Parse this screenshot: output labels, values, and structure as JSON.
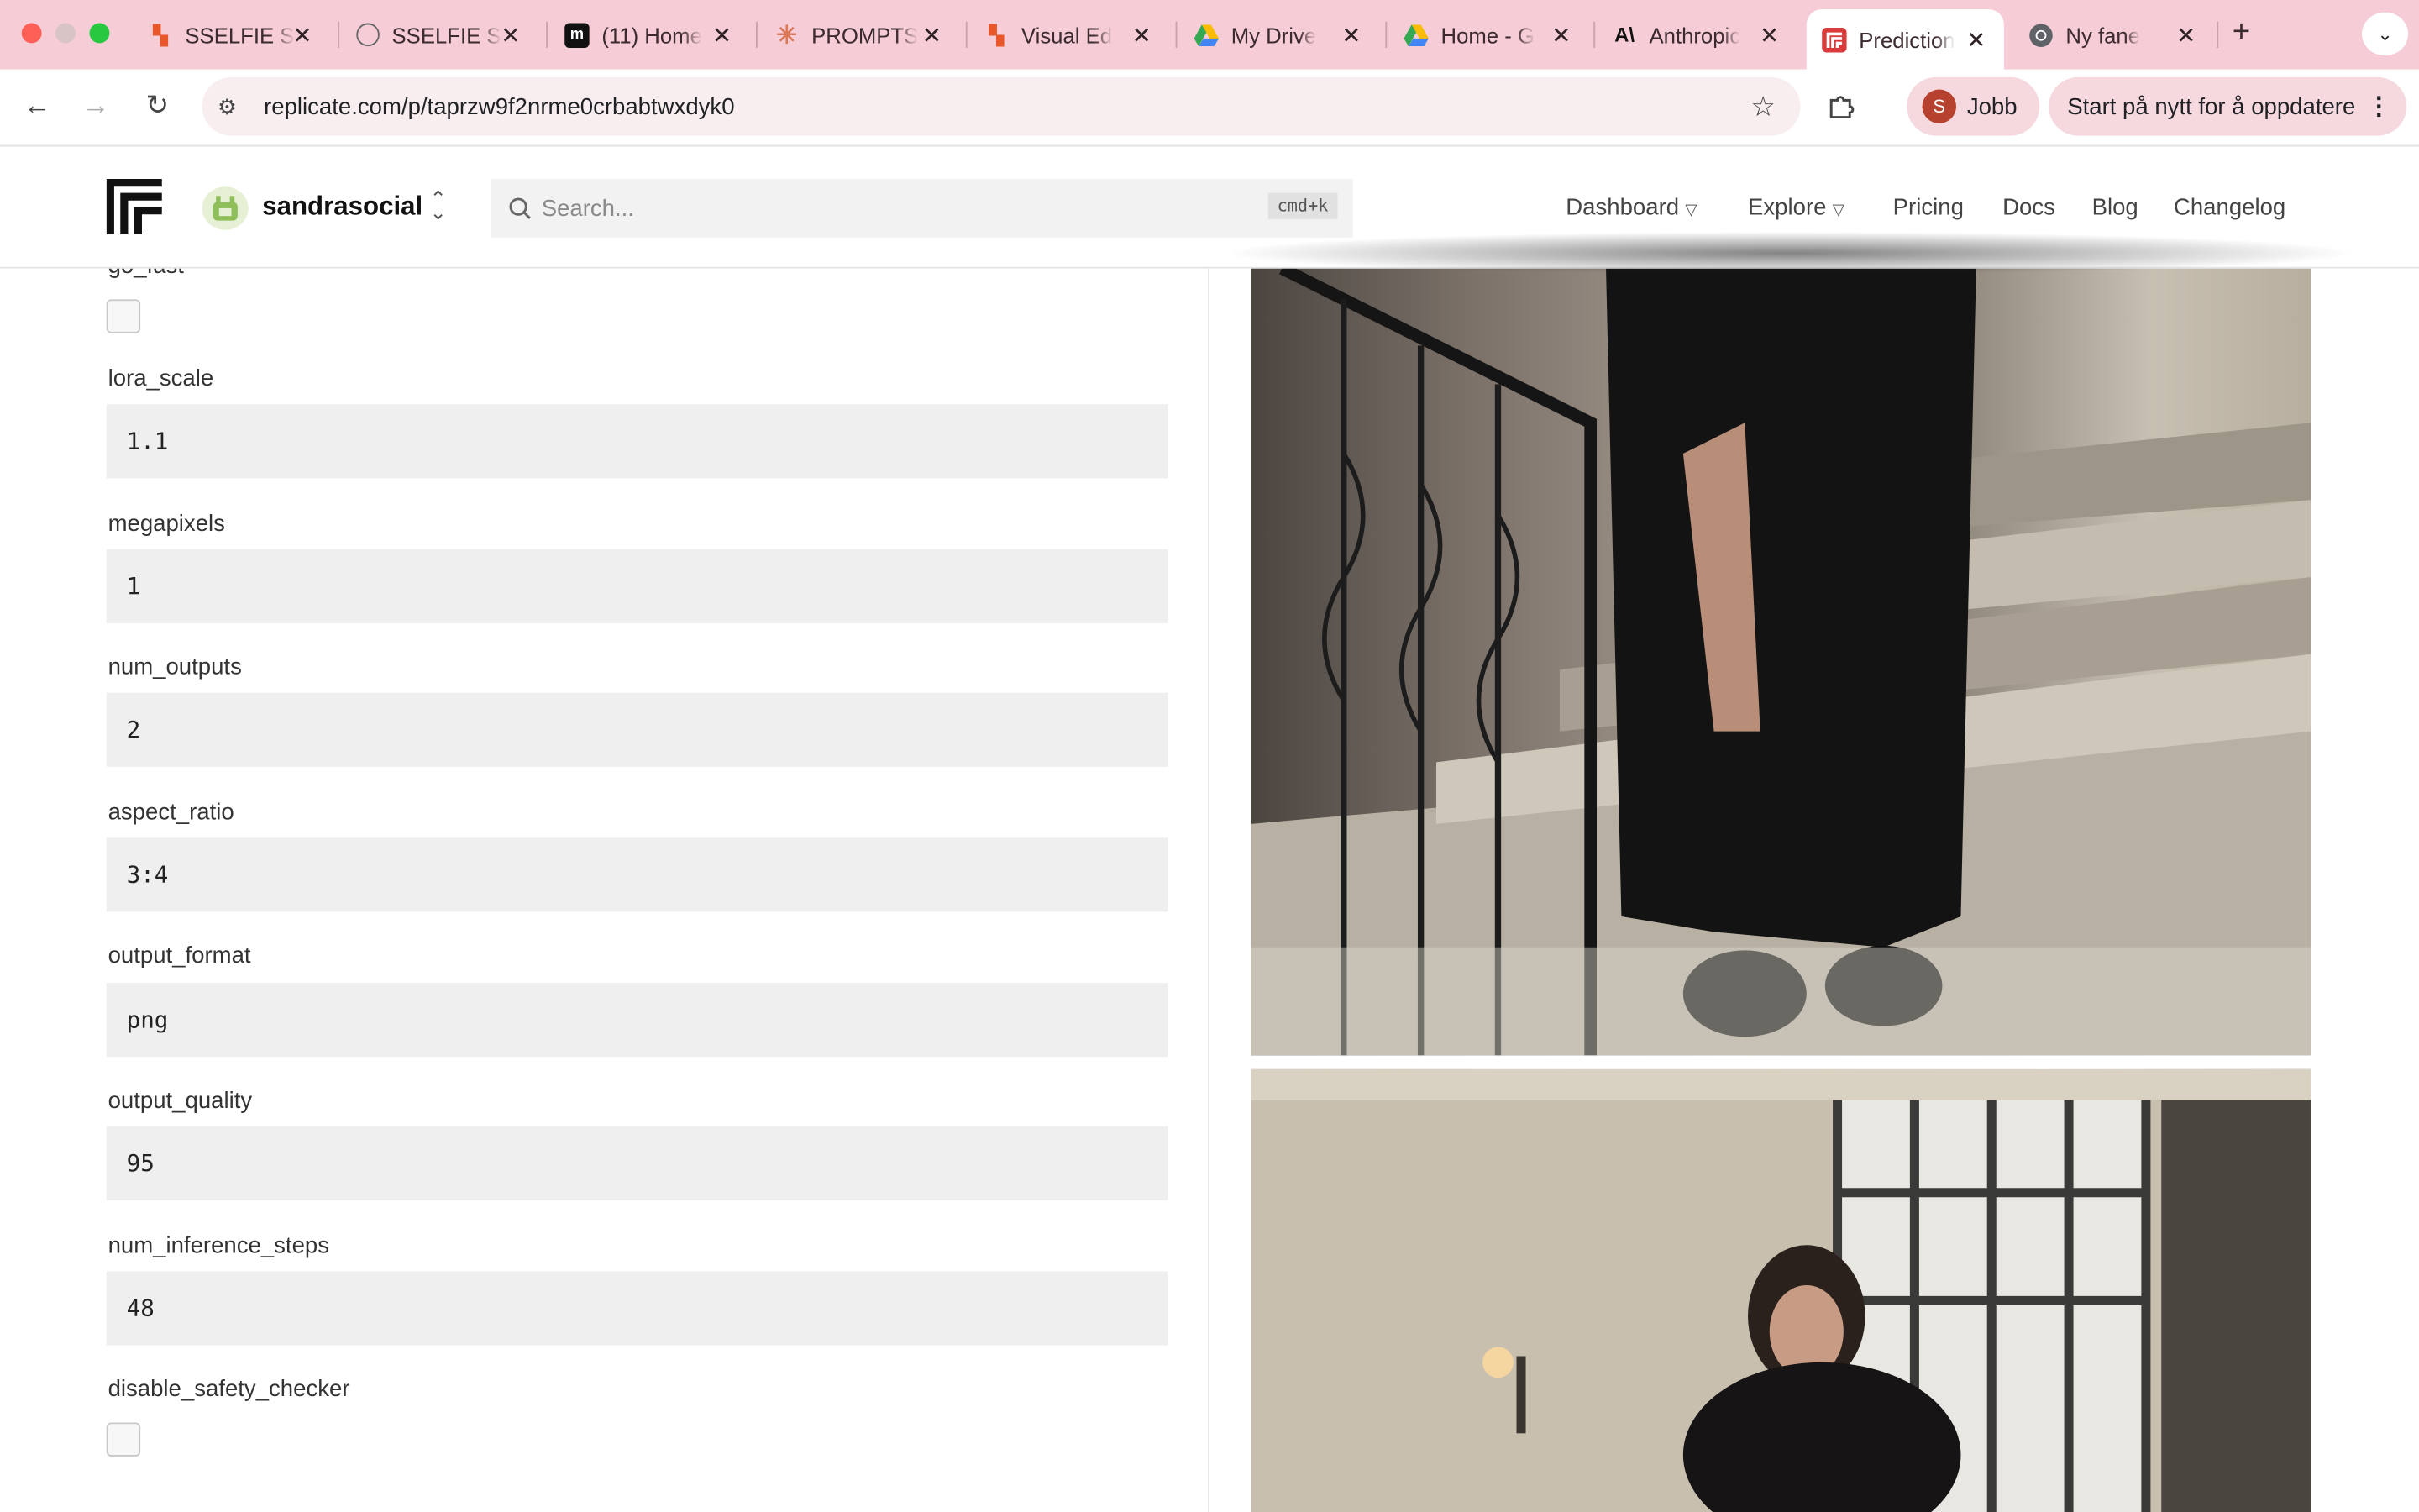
{
  "browser": {
    "tabs": [
      {
        "label": "SSELFIE S",
        "icon": "replicate-orange-icon"
      },
      {
        "label": "SSELFIE S",
        "icon": "globe-icon"
      },
      {
        "label": "(11) Home",
        "icon": "m-logo-icon"
      },
      {
        "label": "PROMPTS",
        "icon": "claude-burst-icon"
      },
      {
        "label": "Visual Ed",
        "icon": "replicate-orange-icon"
      },
      {
        "label": "My Drive",
        "icon": "google-drive-icon"
      },
      {
        "label": "Home - G",
        "icon": "google-drive-icon"
      },
      {
        "label": "Anthropic",
        "icon": "anthropic-icon"
      },
      {
        "label": "Prediction",
        "icon": "replicate-red-icon",
        "active": true
      },
      {
        "label": "Ny fane",
        "icon": "chrome-icon"
      }
    ],
    "url": "replicate.com/p/taprzw9f2nrme0crbabtwxdyk0",
    "profile_initial": "S",
    "profile_name": "Jobb",
    "update_label": "Start på nytt for å oppdatere"
  },
  "site": {
    "account": "sandrasocial",
    "search_placeholder": "Search...",
    "search_shortcut": "cmd+k",
    "nav": {
      "dashboard": "Dashboard",
      "explore": "Explore",
      "pricing": "Pricing",
      "docs": "Docs",
      "blog": "Blog",
      "changelog": "Changelog"
    }
  },
  "form": {
    "go_fast": {
      "label": "go_fast",
      "checked": false
    },
    "lora_scale": {
      "label": "lora_scale",
      "value": "1.1"
    },
    "megapixels": {
      "label": "megapixels",
      "value": "1"
    },
    "num_outputs": {
      "label": "num_outputs",
      "value": "2"
    },
    "aspect_ratio": {
      "label": "aspect_ratio",
      "value": "3:4"
    },
    "output_format": {
      "label": "output_format",
      "value": "png"
    },
    "output_quality": {
      "label": "output_quality",
      "value": "95"
    },
    "num_inference_steps": {
      "label": "num_inference_steps",
      "value": "48"
    },
    "disable_safety_checker": {
      "label": "disable_safety_checker",
      "checked": false
    }
  },
  "colors": {
    "tabstrip": "#f6cdd6",
    "omnibox": "#f8eef0",
    "input_bg": "#efefef",
    "profile_avatar": "#b5412e"
  }
}
